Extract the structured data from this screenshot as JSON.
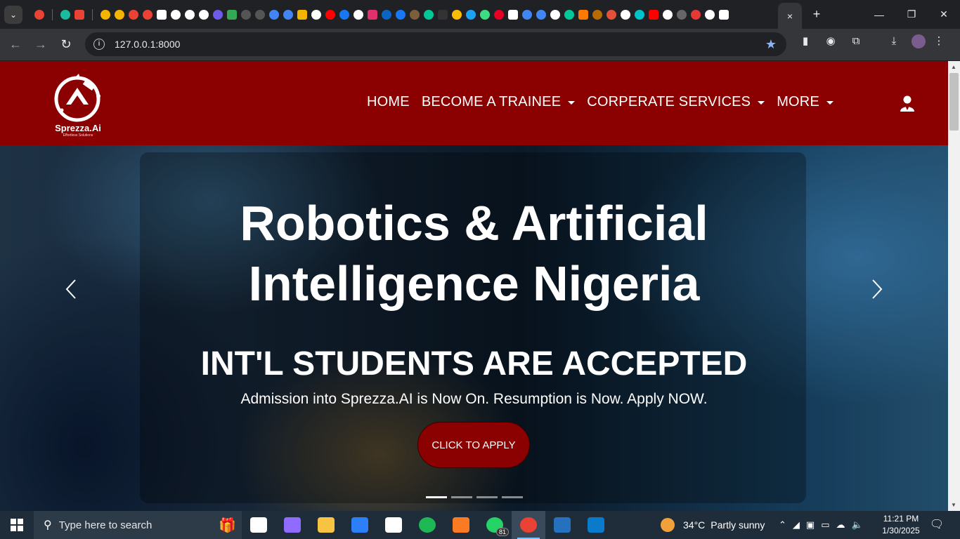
{
  "browser": {
    "url": "127.0.0.1:8000",
    "tab_close": "×",
    "new_tab": "+",
    "controls": {
      "minimize": "—",
      "restore": "❐",
      "close": "✕"
    },
    "favicons": [
      "#ea4335",
      "#1abc9c",
      "#ea4335",
      "#f4b400",
      "#f4b400",
      "#ea4335",
      "#ea4335",
      "#ffffff",
      "#ffffff",
      "#ffffff",
      "#ffffff",
      "#6c5ce7",
      "#34a853",
      "#555555",
      "#555555",
      "#4285f4",
      "#4285f4",
      "#f4b400",
      "#ffffff",
      "#ff0000",
      "#1877f2",
      "#ffffff",
      "#e1306c",
      "#0a66c2",
      "#1877f2",
      "#7b5e3b",
      "#00c896",
      "#333333",
      "#fbbc04",
      "#1da1f2",
      "#3ddc84",
      "#e60023",
      "#ffffff",
      "#4285f4",
      "#4285f4",
      "#ffffff",
      "#00c896",
      "#ff7a00",
      "#b86b00",
      "#e55039",
      "#ffffff",
      "#00c2cb",
      "#ff0000",
      "#ffffff",
      "#666666",
      "#e53935",
      "#ffffff",
      "#ffffff"
    ]
  },
  "site": {
    "logo_text": "Sprezza.Ai",
    "logo_tagline": "Effortless Solutions",
    "brand_color": "#8b0000",
    "menu": [
      {
        "label": "HOME",
        "dropdown": false
      },
      {
        "label": "BECOME A TRAINEE",
        "dropdown": true
      },
      {
        "label": "CORPERATE SERVICES",
        "dropdown": true
      },
      {
        "label": "MORE",
        "dropdown": true
      }
    ],
    "user_icon": "user-icon"
  },
  "hero": {
    "title_line1": "Robotics & Artificial",
    "title_line2": "Intelligence Nigeria",
    "subtitle": "INT'L STUDENTS ARE ACCEPTED",
    "text": "Admission into Sprezza.AI is Now On. Resumption is Now. Apply NOW.",
    "button": "CLICK TO APPLY",
    "slides": 4,
    "active_slide": 1
  },
  "taskbar": {
    "search_placeholder": "Type here to search",
    "whatsapp_badge": "81",
    "weather_temp": "34°C",
    "weather_desc": "Partly sunny",
    "time": "11:21 PM",
    "date": "1/30/2025",
    "apps": [
      {
        "name": "task-view",
        "color": "#ffffff"
      },
      {
        "name": "copilot",
        "color": "#8f6bff"
      },
      {
        "name": "file-explorer",
        "color": "#f6c342"
      },
      {
        "name": "microsoft-store",
        "color": "#2d7ff9"
      },
      {
        "name": "mail",
        "color": "#ffffff"
      },
      {
        "name": "spotify",
        "color": "#1db954"
      },
      {
        "name": "xampp",
        "color": "#fb7a24"
      },
      {
        "name": "whatsapp",
        "color": "#25d366"
      },
      {
        "name": "chrome",
        "color": "#ea4335"
      },
      {
        "name": "powershell",
        "color": "#2671be"
      },
      {
        "name": "vscode",
        "color": "#0a7acb"
      }
    ]
  }
}
